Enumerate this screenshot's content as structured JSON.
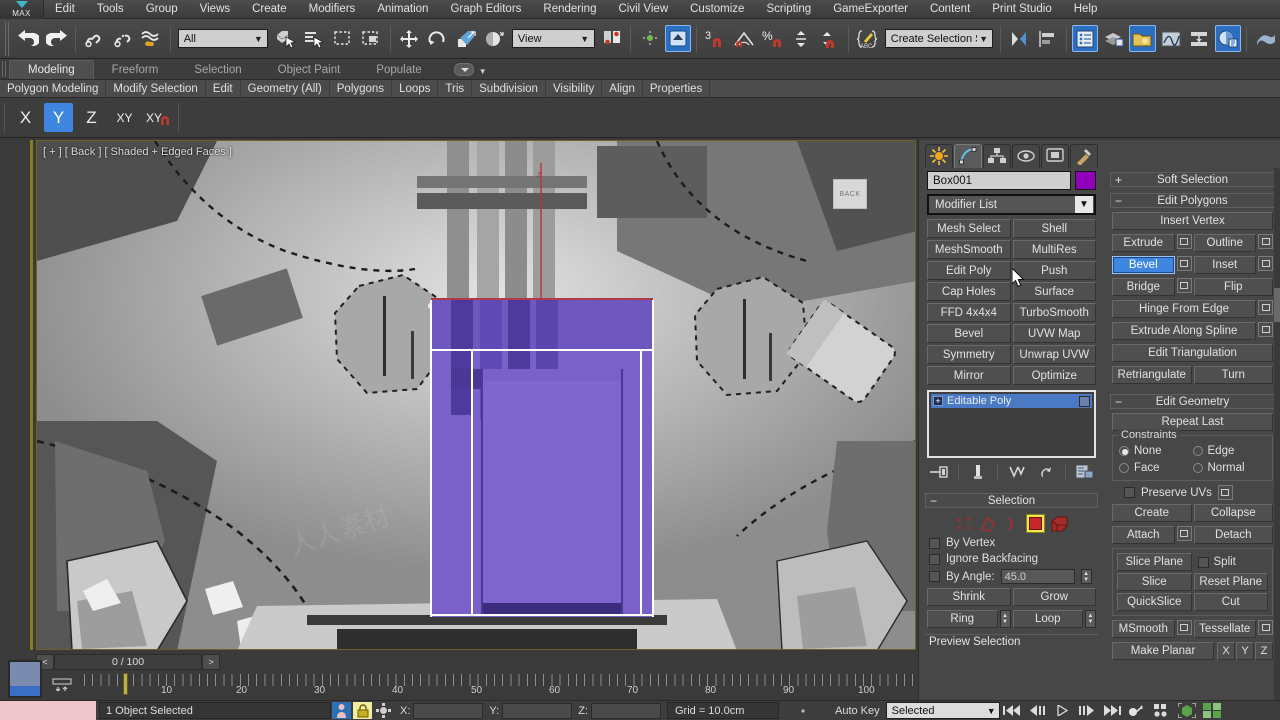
{
  "app": {
    "logo_label": "MAX"
  },
  "menubar": {
    "items": [
      "Edit",
      "Tools",
      "Group",
      "Views",
      "Create",
      "Modifiers",
      "Animation",
      "Graph Editors",
      "Rendering",
      "Civil View",
      "Customize",
      "Scripting",
      "GameExporter",
      "Content",
      "Print Studio",
      "Help"
    ]
  },
  "toolbar": {
    "undo": "undo-arrow",
    "redo": "redo-arrow",
    "select_filter_value": "All",
    "reference_coord_value": "View",
    "named_selection_set_value": "Create Selection Se",
    "snap_count": "3"
  },
  "ribbon": {
    "tabs": [
      {
        "label": "Modeling",
        "active": true
      },
      {
        "label": "Freeform",
        "active": false
      },
      {
        "label": "Selection",
        "active": false
      },
      {
        "label": "Object Paint",
        "active": false
      },
      {
        "label": "Populate",
        "active": false
      }
    ],
    "subtabs": [
      "Polygon Modeling",
      "Modify Selection",
      "Edit",
      "Geometry (All)",
      "Polygons",
      "Loops",
      "Tris",
      "Subdivision",
      "Visibility",
      "Align",
      "Properties"
    ]
  },
  "axisbar": {
    "buttons": [
      {
        "label": "X",
        "active": false
      },
      {
        "label": "Y",
        "active": true
      },
      {
        "label": "Z",
        "active": false
      },
      {
        "label": "XY",
        "active": false
      },
      {
        "label": "XY",
        "active": false
      }
    ]
  },
  "viewport": {
    "label": "[ + ] [ Back ] [ Shaded + Edged Faces ]",
    "viewcube_face": "BACK",
    "selection_color": "#ffffff",
    "object_color": "#7a5fc8"
  },
  "timeslider": {
    "prev_label": "<",
    "next_label": ">",
    "frame_readout": "0 / 100",
    "ticks": [
      "10",
      "20",
      "30",
      "40",
      "50",
      "60",
      "70",
      "80",
      "90",
      "100"
    ]
  },
  "statusbar": {
    "selection_status": "1 Object Selected",
    "x_label": "X:",
    "y_label": "Y:",
    "z_label": "Z:",
    "x_value": "",
    "y_value": "",
    "z_value": "",
    "grid_label": "Grid = 10.0cm",
    "auto_key_label": "Auto Key",
    "key_filter_value": "Selected"
  },
  "command_panel": {
    "tabs": [
      "create-tab",
      "modify-tab",
      "hierarchy-tab",
      "motion-tab",
      "display-tab",
      "utilities-tab"
    ],
    "active_tab_index": 1,
    "object_name": "Box001",
    "object_color": "#9100ba",
    "modifier_list_label": "Modifier List",
    "modifier_buttons": [
      "Mesh Select",
      "Shell",
      "MeshSmooth",
      "MultiRes",
      "Edit Poly",
      "Push",
      "Cap Holes",
      "Surface",
      "FFD 4x4x4",
      "TurboSmooth",
      "Bevel",
      "UVW Map",
      "Symmetry",
      "Unwrap UVW",
      "Mirror",
      "Optimize"
    ],
    "stack": [
      {
        "label": "Editable Poly",
        "selected": true
      }
    ],
    "selection_rollout": {
      "title": "Selection",
      "expanded": true,
      "sub_object_modes": [
        "vertex",
        "edge",
        "border",
        "polygon",
        "element"
      ],
      "active_sub_object": "polygon",
      "by_vertex": "By Vertex",
      "ignore_backfacing": "Ignore Backfacing",
      "by_angle": "By Angle:",
      "by_angle_value": "45.0",
      "shrink": "Shrink",
      "grow": "Grow",
      "ring": "Ring",
      "loop": "Loop"
    },
    "preview_selection_title": "Preview Selection",
    "soft_selection_rollout": {
      "title": "Soft Selection",
      "expanded": false
    },
    "edit_polygons_rollout": {
      "title": "Edit Polygons",
      "expanded": true,
      "insert_vertex": "Insert Vertex",
      "extrude": "Extrude",
      "outline": "Outline",
      "bevel": "Bevel",
      "bevel_active": true,
      "inset": "Inset",
      "bridge": "Bridge",
      "flip": "Flip",
      "hinge_from_edge": "Hinge From Edge",
      "extrude_along_spline": "Extrude Along Spline",
      "edit_triangulation": "Edit Triangulation",
      "retriangulate": "Retriangulate",
      "turn": "Turn"
    },
    "edit_geometry_rollout": {
      "title": "Edit Geometry",
      "expanded": true,
      "repeat_last": "Repeat Last",
      "constraints_title": "Constraints",
      "constraints": [
        {
          "label": "None",
          "selected": true
        },
        {
          "label": "Edge",
          "selected": false
        },
        {
          "label": "Face",
          "selected": false
        },
        {
          "label": "Normal",
          "selected": false
        }
      ],
      "preserve_uvs": "Preserve UVs",
      "create": "Create",
      "collapse": "Collapse",
      "attach": "Attach",
      "detach": "Detach",
      "slice_plane": "Slice Plane",
      "split": "Split",
      "slice": "Slice",
      "reset_plane": "Reset Plane",
      "quickslice": "QuickSlice",
      "cut": "Cut",
      "msmooth": "MSmooth",
      "tessellate": "Tessellate",
      "make_planar": "Make Planar",
      "axis_buttons": [
        "X",
        "Y",
        "Z"
      ]
    }
  }
}
